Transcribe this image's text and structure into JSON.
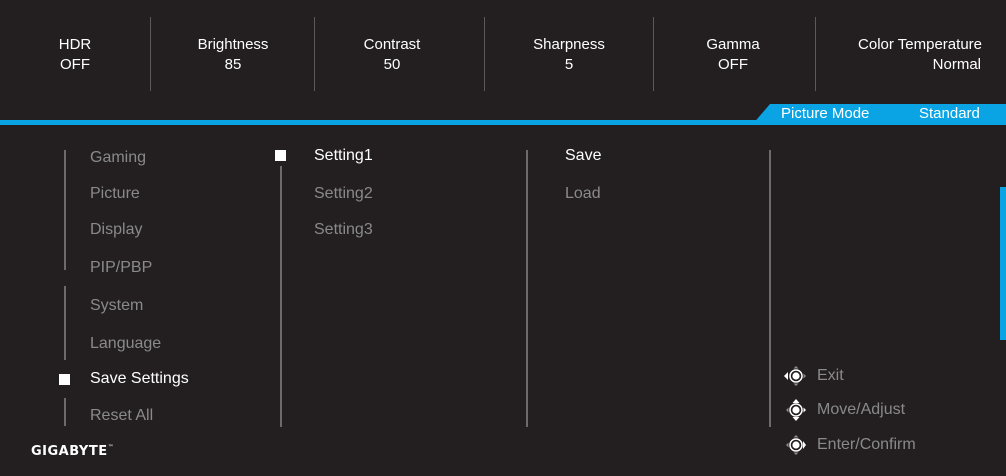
{
  "status_bar": [
    {
      "name": "HDR",
      "value": "OFF"
    },
    {
      "name": "Brightness",
      "value": "85"
    },
    {
      "name": "Contrast",
      "value": "50"
    },
    {
      "name": "Sharpness",
      "value": "5"
    },
    {
      "name": "Gamma",
      "value": "OFF"
    },
    {
      "name": "Color Temperature",
      "value": "Normal"
    }
  ],
  "picture_mode": {
    "label": "Picture Mode",
    "value": "Standard"
  },
  "main_menu": [
    "Gaming",
    "Picture",
    "Display",
    "PIP/PBP",
    "System",
    "Language",
    "Save Settings",
    "Reset All"
  ],
  "main_menu_selected": "Save Settings",
  "settings_menu": [
    "Setting1",
    "Setting2",
    "Setting3"
  ],
  "settings_menu_selected": "Setting1",
  "action_menu": [
    "Save",
    "Load"
  ],
  "action_menu_selected": "Save",
  "key_hints": [
    {
      "icon": "joystick-left-icon",
      "label": "Exit"
    },
    {
      "icon": "joystick-move-icon",
      "label": "Move/Adjust"
    },
    {
      "icon": "joystick-press-icon",
      "label": "Enter/Confirm"
    }
  ],
  "brand": "GIGABYTE",
  "brand_mark": "™",
  "colors": {
    "background": "#231f20",
    "accent": "#0aa4e4",
    "active_text": "#ffffff",
    "inactive_text": "#8a8a8a"
  }
}
